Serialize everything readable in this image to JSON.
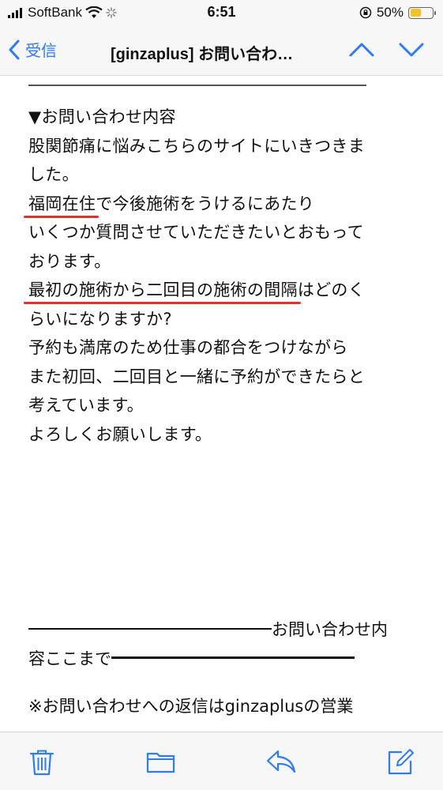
{
  "status_bar": {
    "carrier": "SoftBank",
    "time": "6:51",
    "battery_percent": "50%",
    "battery_level": 0.5,
    "icons": [
      "signal-icon",
      "wifi-icon",
      "loading-icon",
      "orientation-lock-icon",
      "battery-icon"
    ]
  },
  "nav": {
    "back_label": "受信",
    "title": "[ginzaplus] お問い合わ…",
    "icons": [
      "chevron-left-icon",
      "chevron-up-icon",
      "chevron-down-icon"
    ]
  },
  "body": {
    "line1": "▼お問い合わせ内容",
    "line2": "股関節痛に悩みこちらのサイトにいきつきま",
    "line3": "した。",
    "line4_highlight": "福岡在住",
    "line4_rest": "で今後施術をうけるにあたり",
    "line5": "いくつか質問させていただきたいとおもって",
    "line6": "おります。",
    "line7_highlight": "最初の施術から二回目の施術の間隔",
    "line7_rest": "はどのく",
    "line8": "らいになりますか?",
    "line9": "予約も満席のため仕事の都合をつけながら",
    "line10": "また初回、二回目と一緒に予約ができたらと",
    "line11": "考えています。",
    "line12": "よろしくお願いします。"
  },
  "footer": {
    "line1_text": "お問い合わせ内",
    "line2_text": "容ここまで",
    "reply_note": "※お問い合わせへの返信はginzaplusの営業"
  },
  "colors": {
    "accent": "#2f7bf5",
    "highlight_underline": "#e0312a",
    "battery": "#f2c230"
  },
  "toolbar": {
    "icons": [
      "trash-icon",
      "folder-icon",
      "reply-icon",
      "compose-icon"
    ]
  }
}
